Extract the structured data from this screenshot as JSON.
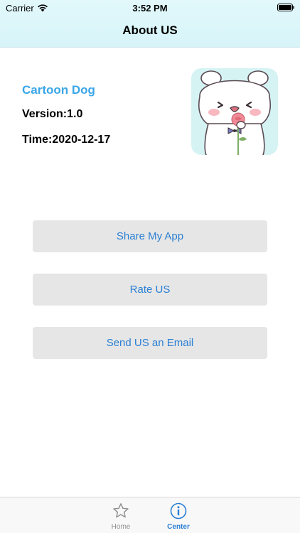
{
  "status_bar": {
    "carrier": "Carrier",
    "time": "3:52 PM"
  },
  "nav": {
    "title": "About US"
  },
  "app_info": {
    "name": "Cartoon Dog",
    "version": "Version:1.0",
    "time": "Time:2020-12-17",
    "icon": "cartoon-bear-with-rose-icon"
  },
  "buttons": {
    "share": "Share My App",
    "rate": "Rate US",
    "email": "Send US an Email"
  },
  "tab_bar": {
    "tabs": [
      {
        "label": "Home",
        "icon": "star-icon",
        "selected": false
      },
      {
        "label": "Center",
        "icon": "info-icon",
        "selected": true
      }
    ]
  },
  "colors": {
    "accent": "#2a7fd4",
    "app_name": "#3aa6e8",
    "nav_background": "#d9f5f9",
    "button_background": "#e6e6e6"
  }
}
